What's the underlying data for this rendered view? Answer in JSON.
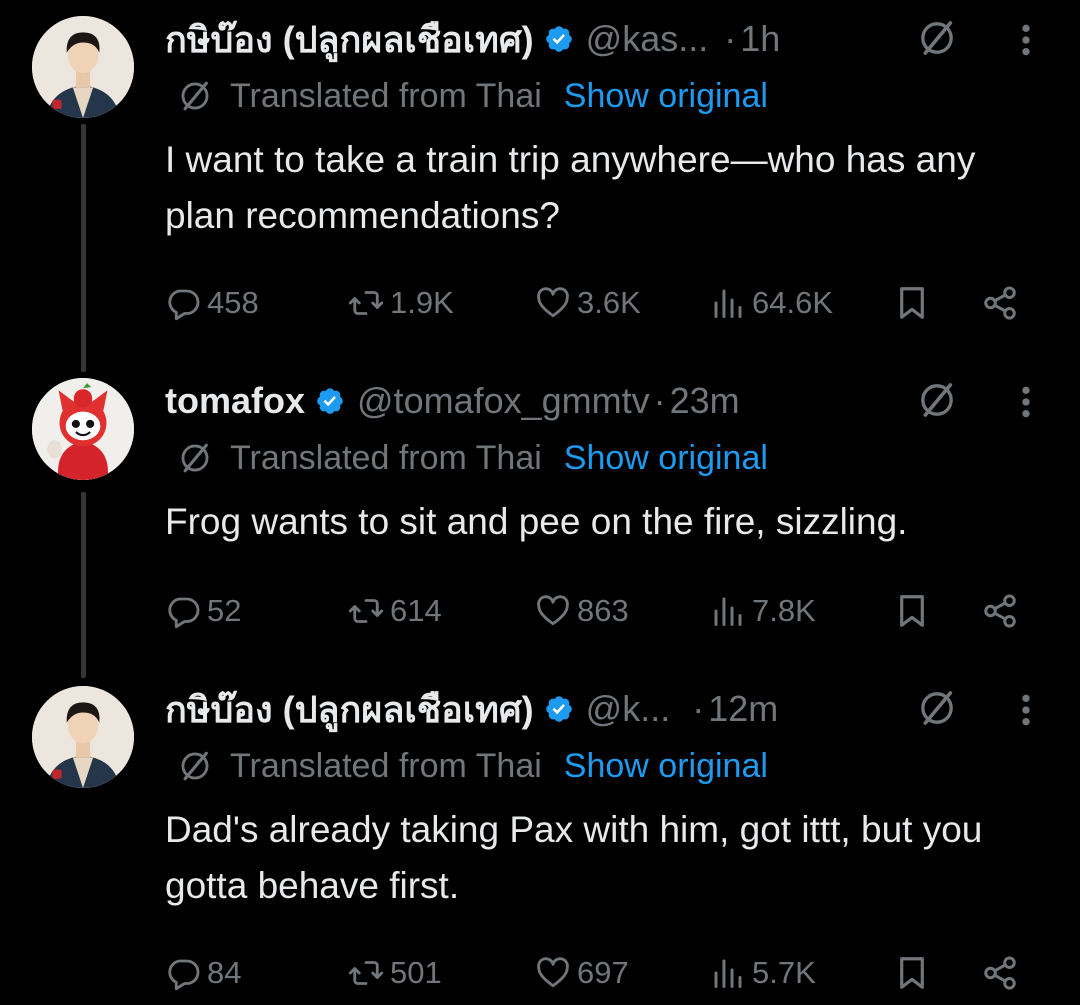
{
  "colors": {
    "background": "#000000",
    "text": "#e7e9ea",
    "muted": "#71767b",
    "accent": "#1d9bf0",
    "verified": "#1d9bf0"
  },
  "tweets": [
    {
      "display_name": "กษิบ๊อง (ปลูกผลเชือเทศ)",
      "handle": "@kas...",
      "separator": "·",
      "time": "1h",
      "verified": true,
      "translated_label": "Translated from Thai",
      "show_original": "Show original",
      "text": "I want to take a train trip anywhere—who has any plan recommendations?",
      "replies": "458",
      "reposts": "1.9K",
      "likes": "3.6K",
      "views": "64.6K",
      "icons": [
        "verified-icon",
        "grok-icon",
        "more-icon",
        "translate-icon",
        "reply-icon",
        "repost-icon",
        "like-icon",
        "views-icon",
        "bookmark-icon",
        "share-icon"
      ]
    },
    {
      "display_name": "tomafox",
      "handle": "@tomafox_gmmtv",
      "separator": "·",
      "time": "23m",
      "verified": true,
      "translated_label": "Translated from Thai",
      "show_original": "Show original",
      "text": "Frog wants to sit and pee on the fire, sizzling.",
      "replies": "52",
      "reposts": "614",
      "likes": "863",
      "views": "7.8K"
    },
    {
      "display_name": "กษิบ๊อง (ปลูกผลเชือเทศ)",
      "handle": "@k...",
      "separator": "·",
      "time": "12m",
      "verified": true,
      "translated_label": "Translated from Thai",
      "show_original": "Show original",
      "text": "Dad's already taking Pax with him, got ittt, but you gotta behave first.",
      "replies": "84",
      "reposts": "501",
      "likes": "697",
      "views": "5.7K"
    }
  ]
}
